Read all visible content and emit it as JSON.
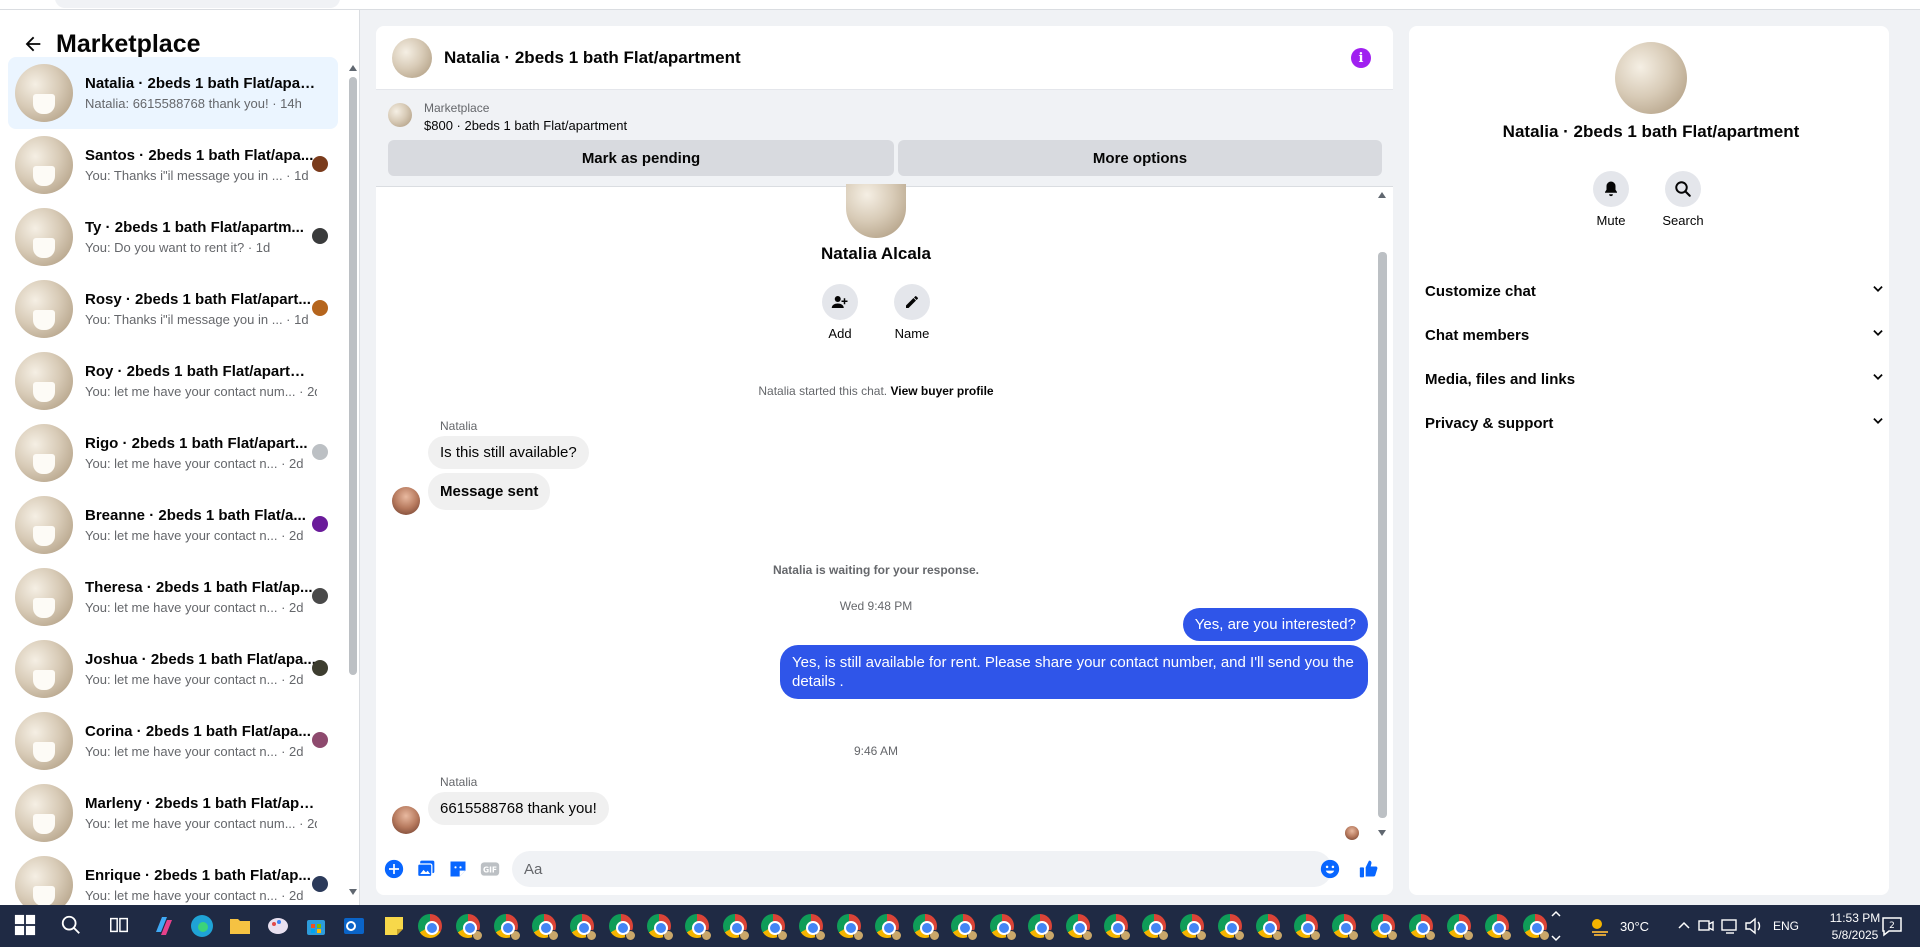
{
  "sidebar": {
    "title": "Marketplace",
    "conversations": [
      {
        "name": "Natalia · 2beds 1 bath Flat/apart...",
        "preview": "Natalia: 6615588768 thank you! · 14h",
        "active": true,
        "avatar_color": ""
      },
      {
        "name": "Santos · 2beds 1 bath Flat/apa...",
        "preview": "You: Thanks i\"il message you in ... · 1d",
        "avatar_color": "#7a3b1c"
      },
      {
        "name": "Ty · 2beds 1 bath Flat/apartm...",
        "preview": "You: Do you want to rent it? · 1d",
        "avatar_color": "#3a3b3c"
      },
      {
        "name": "Rosy · 2beds 1 bath Flat/apart...",
        "preview": "You: Thanks i\"il message you in ... · 1d",
        "avatar_color": "#b5651d"
      },
      {
        "name": "Roy · 2beds 1 bath Flat/apartment",
        "preview": "You: let me have your contact num... · 2d",
        "avatar_color": ""
      },
      {
        "name": "Rigo · 2beds 1 bath Flat/apart...",
        "preview": "You: let me have your contact n... · 2d",
        "avatar_color": "#bcc0c4"
      },
      {
        "name": "Breanne · 2beds 1 bath Flat/a...",
        "preview": "You: let me have your contact n... · 2d",
        "avatar_color": "#6a1b9a"
      },
      {
        "name": "Theresa · 2beds 1 bath Flat/ap...",
        "preview": "You: let me have your contact n... · 2d",
        "avatar_color": "#4a4a4a"
      },
      {
        "name": "Joshua · 2beds 1 bath Flat/apa...",
        "preview": "You: let me have your contact n... · 2d",
        "avatar_color": "#3d3d2f"
      },
      {
        "name": "Corina · 2beds 1 bath Flat/apa...",
        "preview": "You: let me have your contact n... · 2d",
        "avatar_color": "#8e4a6e"
      },
      {
        "name": "Marleny · 2beds 1 bath Flat/apar...",
        "preview": "You: let me have your contact num... · 2d",
        "avatar_color": ""
      },
      {
        "name": "Enrique · 2beds 1 bath Flat/ap...",
        "preview": "You: let me have your contact n... · 2d",
        "avatar_color": "#2b3a5a"
      }
    ]
  },
  "chat": {
    "title": "Natalia · 2beds 1 bath Flat/apartment",
    "marketplace_label": "Marketplace",
    "listing": "$800 · 2beds 1 bath Flat/apartment",
    "mark_pending": "Mark as pending",
    "more_options": "More options",
    "profile_name": "Natalia Alcala",
    "add_label": "Add",
    "name_label": "Name",
    "started_text": "Natalia started this chat.",
    "view_buyer": "View buyer profile",
    "sender1": "Natalia",
    "msg1": "Is this still available?",
    "msg2": "Message sent",
    "waiting": "Natalia is waiting for your response.",
    "time1": "Wed 9:48 PM",
    "out1": "Yes, are you interested?",
    "out2": "Yes, is still available for rent. Please share your contact number, and I'll send you the details .",
    "time2": "9:46 AM",
    "sender2": "Natalia",
    "msg3": "6615588768 thank you!",
    "composer_placeholder": "Aa"
  },
  "panel": {
    "title": "Natalia · 2beds 1 bath Flat/apartment",
    "mute": "Mute",
    "search": "Search",
    "sections": [
      "Customize chat",
      "Chat members",
      "Media, files and links",
      "Privacy & support"
    ]
  },
  "taskbar": {
    "temp": "30°C",
    "lang": "ENG",
    "time": "11:53 PM",
    "date": "5/8/2025",
    "notif": "2"
  },
  "colors": {
    "accent": "#2f55e9",
    "info": "#a020f0",
    "messenger_blue": "#0866ff"
  }
}
